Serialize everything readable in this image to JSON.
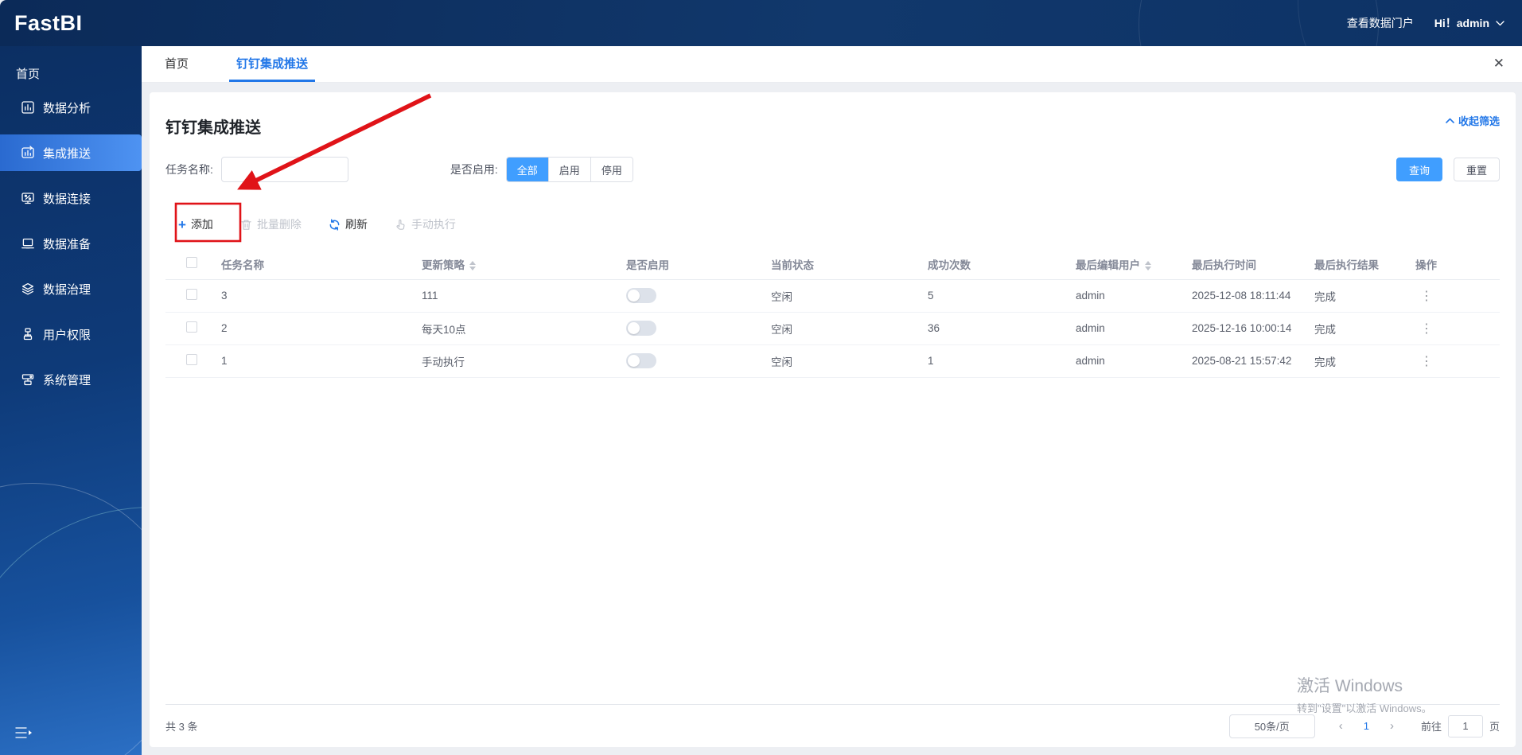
{
  "header": {
    "logo": "FastBI",
    "portal_link": "查看数据门户",
    "user_greeting": "Hi！admin"
  },
  "sidebar": {
    "home": "首页",
    "items": [
      {
        "label": "数据分析",
        "icon": "bar-chart-icon"
      },
      {
        "label": "集成推送",
        "icon": "push-chart-icon",
        "active": true
      },
      {
        "label": "数据连接",
        "icon": "monitor-percent-icon"
      },
      {
        "label": "数据准备",
        "icon": "laptop-icon"
      },
      {
        "label": "数据治理",
        "icon": "layers-icon"
      },
      {
        "label": "用户权限",
        "icon": "org-chart-icon"
      },
      {
        "label": "系统管理",
        "icon": "server-icon"
      }
    ]
  },
  "tabs": [
    {
      "label": "首页"
    },
    {
      "label": "钉钉集成推送",
      "active": true
    }
  ],
  "page": {
    "title": "钉钉集成推送",
    "collapse_filter": "收起筛选",
    "filter": {
      "task_name_label": "任务名称:",
      "task_name_value": "",
      "enable_label": "是否启用:",
      "enable_options": [
        "全部",
        "启用",
        "停用"
      ],
      "enable_selected": "全部",
      "search_label": "查询",
      "reset_label": "重置"
    },
    "toolbar": {
      "add": "添加",
      "batch_delete": "批量删除",
      "refresh": "刷新",
      "manual_run": "手动执行"
    }
  },
  "table": {
    "columns": [
      "任务名称",
      "更新策略",
      "是否启用",
      "当前状态",
      "成功次数",
      "最后编辑用户",
      "最后执行时间",
      "最后执行结果",
      "操作"
    ],
    "rows": [
      {
        "name": "3",
        "strategy": "111",
        "enabled": false,
        "status": "空闲",
        "success": "5",
        "editor": "admin",
        "time": "2025-12-08 18:11:44",
        "result": "完成"
      },
      {
        "name": "2",
        "strategy": "每天10点",
        "enabled": false,
        "status": "空闲",
        "success": "36",
        "editor": "admin",
        "time": "2025-12-16 10:00:14",
        "result": "完成"
      },
      {
        "name": "1",
        "strategy": "手动执行",
        "enabled": false,
        "status": "空闲",
        "success": "1",
        "editor": "admin",
        "time": "2025-08-21 15:57:42",
        "result": "完成"
      }
    ]
  },
  "pagination": {
    "total_label": "共 3 条",
    "page_size": "50条/页",
    "current_page": "1",
    "goto_label": "前往",
    "goto_value": "1",
    "unit_label": "页"
  },
  "watermark": {
    "line1": "激活 Windows",
    "line2": "转到\"设置\"以激活 Windows。"
  },
  "icons": {
    "plus": "+",
    "close": "✕",
    "prev": "‹",
    "next": "›",
    "more": "⋮"
  },
  "colors": {
    "accent_blue": "#2277e8",
    "button_blue": "#409eff",
    "sidebar_top": "#0c2f63",
    "sidebar_bottom": "#2b6fc4",
    "annotation_red": "#e01318"
  }
}
